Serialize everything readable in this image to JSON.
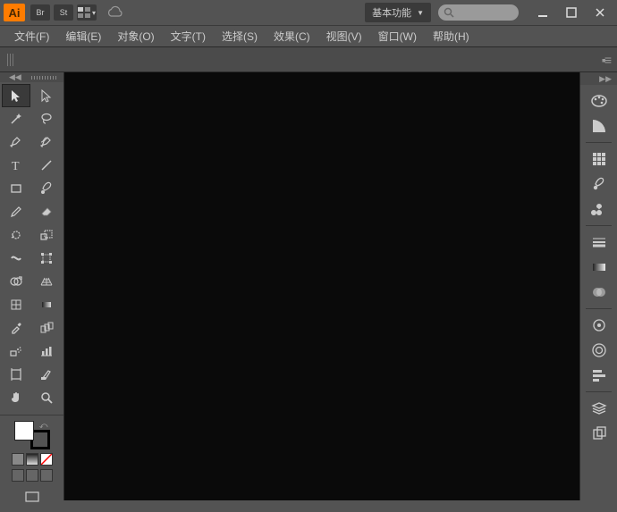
{
  "app": {
    "logo_text": "Ai"
  },
  "titlebar": {
    "mini_buttons": [
      "Br",
      "St"
    ],
    "workspace_label": "基本功能",
    "search_placeholder": ""
  },
  "menubar": [
    "文件(F)",
    "编辑(E)",
    "对象(O)",
    "文字(T)",
    "选择(S)",
    "效果(C)",
    "视图(V)",
    "窗口(W)",
    "帮助(H)"
  ],
  "tools": [
    [
      "selection",
      "direct-selection"
    ],
    [
      "magic-wand",
      "lasso"
    ],
    [
      "pen",
      "curvature-pen"
    ],
    [
      "type",
      "line-segment"
    ],
    [
      "rectangle",
      "paintbrush"
    ],
    [
      "pencil",
      "eraser"
    ],
    [
      "rotate",
      "scale"
    ],
    [
      "width",
      "free-transform"
    ],
    [
      "shape-builder",
      "perspective-grid"
    ],
    [
      "mesh",
      "gradient"
    ],
    [
      "eyedropper",
      "blend"
    ],
    [
      "symbol-sprayer",
      "column-graph"
    ],
    [
      "artboard",
      "slice"
    ],
    [
      "hand",
      "zoom"
    ]
  ],
  "right_panels": [
    "color",
    "color-guide",
    "swatches",
    "brushes",
    "symbols",
    "stroke",
    "gradient",
    "transparency",
    "appearance",
    "graphic-styles",
    "layers",
    "artboards"
  ]
}
